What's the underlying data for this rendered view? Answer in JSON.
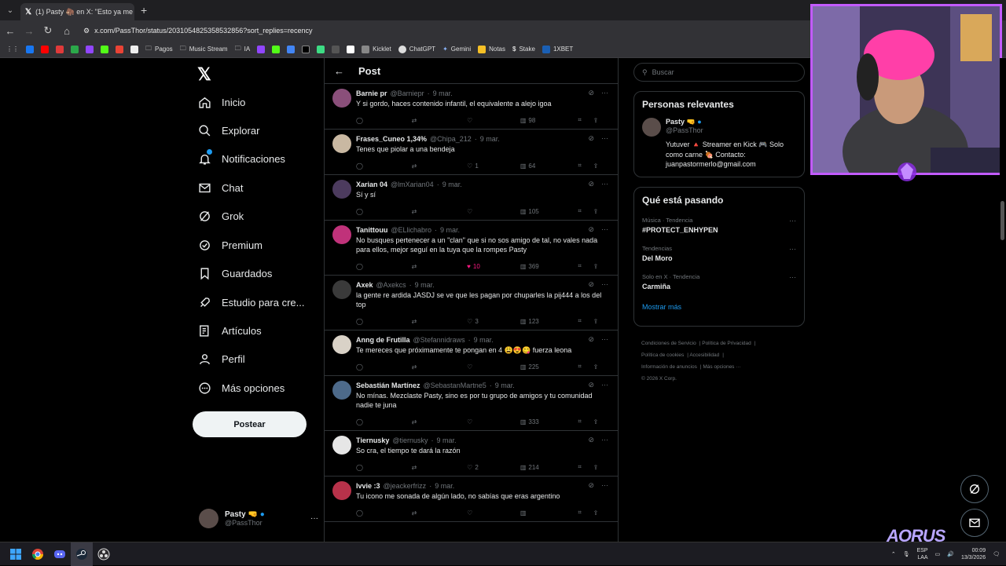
{
  "browser": {
    "tab_title": "(1) Pasty 🦣 en X: \"Esto ya me l",
    "url": "x.com/PassThor/status/2031054825358532856?sort_replies=recency",
    "bookmarks": [
      "Pagos",
      "Music Stream",
      "IA",
      "Kicklet",
      "ChatGPT",
      "Gemini",
      "Notas",
      "Stake",
      "1XBET"
    ]
  },
  "nav": {
    "items": [
      "Inicio",
      "Explorar",
      "Notificaciones",
      "Chat",
      "Grok",
      "Premium",
      "Guardados",
      "Estudio para cre...",
      "Artículos",
      "Perfil",
      "Más opciones"
    ],
    "post_label": "Postear",
    "account_name": "Pasty 🤜",
    "account_handle": "@PassThor"
  },
  "header": {
    "title": "Post"
  },
  "replies": [
    {
      "name": "Barnie pr",
      "handle": "@Barniepr",
      "date": "9 mar.",
      "text": "Y si gordo, haces contenido infantil, el equivalente a alejo igoa",
      "likes": "",
      "views": "98",
      "avatar": "#8a4f7a"
    },
    {
      "name": "Frases_Cuneo 1,34%",
      "handle": "@Chipa_212",
      "date": "9 mar.",
      "text": "Tenes que piolar a una bendeja",
      "likes": "1",
      "views": "64",
      "avatar": "#c9b8a2"
    },
    {
      "name": "Xarian 04",
      "handle": "@lmXarian04",
      "date": "9 mar.",
      "text": "Sí y sí",
      "likes": "",
      "views": "105",
      "avatar": "#4c3b5e"
    },
    {
      "name": "Tanittouu",
      "handle": "@ELlichabro",
      "date": "9 mar.",
      "text": "No busques pertenecer a un \"clan\" que si no sos amigo de tal, no vales nada para ellos, mejor seguí en la tuya que la rompes Pasty",
      "likes": "10",
      "views": "369",
      "avatar": "#c0327a",
      "liked": true
    },
    {
      "name": "Axek",
      "handle": "@Axekcs",
      "date": "9 mar.",
      "text": "la gente re ardida JASDJ se ve que les pagan por chuparles la pij444 a los del top",
      "likes": "3",
      "views": "123",
      "avatar": "#3a3a3a"
    },
    {
      "name": "Anng de Frutilla",
      "handle": "@Stefannidraws",
      "date": "9 mar.",
      "text": "Te mereces que próximamente te pongan en 4 😩😍😋 fuerza leona",
      "likes": "",
      "views": "225",
      "avatar": "#d9d2c7"
    },
    {
      "name": "Sebastián Martínez",
      "handle": "@SebastanMartne5",
      "date": "9 mar.",
      "text": "No mínas. Mezclaste Pasty, sino es por tu grupo de amigos y tu comunidad nadie te juna",
      "likes": "",
      "views": "333",
      "avatar": "#4d6a8a"
    },
    {
      "name": "Tiernusky",
      "handle": "@tiernusky",
      "date": "9 mar.",
      "text": "So cra, el tiempo te dará la razón",
      "likes": "2",
      "views": "214",
      "avatar": "#e6e6e6"
    },
    {
      "name": "Ivvie :3",
      "handle": "@jeackerfrizz",
      "date": "9 mar.",
      "text": "Tu icono me sonada de algún lado, no sabías que eras argentino",
      "likes": "",
      "views": "",
      "avatar": "#b8324a"
    }
  ],
  "right": {
    "search_placeholder": "Buscar",
    "relevant_title": "Personas relevantes",
    "rel_name": "Pasty 🤜",
    "rel_handle": "@PassThor",
    "rel_bio_1": "Yutuver 🔺 Streamer en Kick 🎮 Solo",
    "rel_bio_2": "como carne 🍖 Contacto:",
    "rel_bio_3": "juanpastormerlo@gmail.com",
    "trending_title": "Qué está pasando",
    "trends": [
      {
        "context": "Música · Tendencia",
        "title": "#PROTECT_ENHYPEN"
      },
      {
        "context": "Tendencias",
        "title": "Del Moro"
      },
      {
        "context": "Solo en X · Tendencia",
        "title": "Carmiña"
      }
    ],
    "show_more": "Mostrar más",
    "footer": [
      "Condiciones de Servicio",
      "Política de Privacidad",
      "Política de cookies",
      "Accesibilidad",
      "Información de anuncios",
      "Más opciones ···",
      "© 2026 X Corp."
    ]
  },
  "taskbar": {
    "lang": "ESP",
    "lang2": "LAA",
    "time": "00:09",
    "date": "13/3/2026"
  },
  "overlay": {
    "brand": "AORUS"
  }
}
